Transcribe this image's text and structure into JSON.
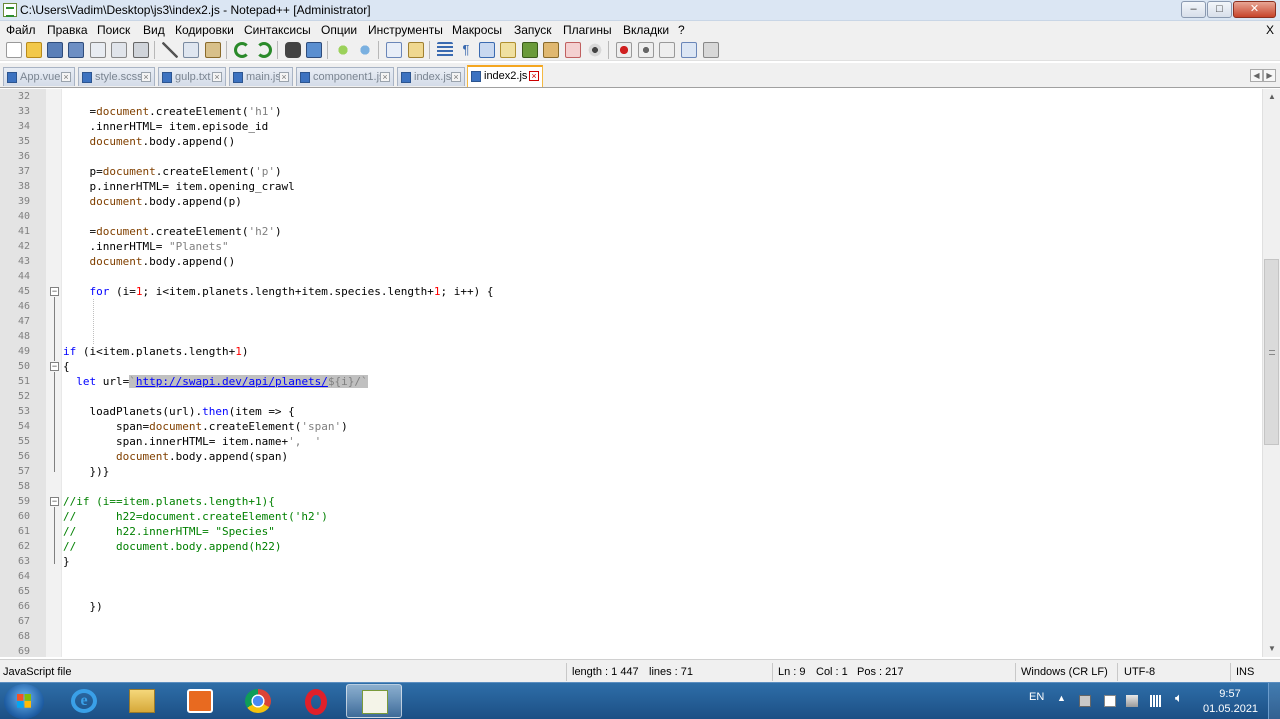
{
  "window": {
    "title": "C:\\Users\\Vadim\\Desktop\\js3\\index2.js - Notepad++ [Administrator]",
    "minimize": "–",
    "maximize": "□",
    "close": "✕"
  },
  "menu": {
    "items": [
      "Файл",
      "Правка",
      "Поиск",
      "Вид",
      "Кодировки",
      "Синтаксисы",
      "Опции",
      "Инструменты",
      "Макросы",
      "Запуск",
      "Плагины",
      "Вкладки",
      "?"
    ],
    "close_label": "X"
  },
  "tabs": [
    {
      "label": "App.vue"
    },
    {
      "label": "style.scss"
    },
    {
      "label": "gulp.txt"
    },
    {
      "label": "main.js"
    },
    {
      "label": "component1.js"
    },
    {
      "label": "index.js"
    },
    {
      "label": "index2.js",
      "active": true
    }
  ],
  "editor": {
    "lines": [
      {
        "n": "32",
        "t": ""
      },
      {
        "n": "33",
        "t": "    h1=document.createElement('h1')"
      },
      {
        "n": "34",
        "t": "    h1.innerHTML= item.episode_id"
      },
      {
        "n": "35",
        "t": "    document.body.append(h1)"
      },
      {
        "n": "36",
        "t": ""
      },
      {
        "n": "37",
        "t": "    p=document.createElement('p')"
      },
      {
        "n": "38",
        "t": "    p.innerHTML= item.opening_crawl"
      },
      {
        "n": "39",
        "t": "    document.body.append(p)"
      },
      {
        "n": "40",
        "t": ""
      },
      {
        "n": "41",
        "t": "    h2=document.createElement('h2')"
      },
      {
        "n": "42",
        "t": "    h2.innerHTML= \"Planets\""
      },
      {
        "n": "43",
        "t": "    document.body.append(h2)"
      },
      {
        "n": "44",
        "t": ""
      },
      {
        "n": "45",
        "t": "    for (i=1; i<item.planets.length+item.species.length+1; i++) {"
      },
      {
        "n": "46",
        "t": ""
      },
      {
        "n": "47",
        "t": ""
      },
      {
        "n": "48",
        "t": ""
      },
      {
        "n": "49",
        "t": "if (i<item.planets.length+1)"
      },
      {
        "n": "50",
        "t": "{"
      },
      {
        "n": "51",
        "t": "  let url=`http://swapi.dev/api/planets/${i}/`"
      },
      {
        "n": "52",
        "t": ""
      },
      {
        "n": "53",
        "t": "    loadPlanets(url).then(item => {"
      },
      {
        "n": "54",
        "t": "        span=document.createElement('span')"
      },
      {
        "n": "55",
        "t": "        span.innerHTML= item.name+',  '"
      },
      {
        "n": "56",
        "t": "        document.body.append(span)"
      },
      {
        "n": "57",
        "t": "    })}"
      },
      {
        "n": "58",
        "t": ""
      },
      {
        "n": "59",
        "t": "//if (i==item.planets.length+1){"
      },
      {
        "n": "60",
        "t": "//      h22=document.createElement('h2')"
      },
      {
        "n": "61",
        "t": "//      h22.innerHTML= \"Species\""
      },
      {
        "n": "62",
        "t": "//      document.body.append(h22)"
      },
      {
        "n": "63",
        "t": "}"
      },
      {
        "n": "64",
        "t": ""
      },
      {
        "n": "65",
        "t": ""
      },
      {
        "n": "66",
        "t": "    })"
      },
      {
        "n": "67",
        "t": ""
      },
      {
        "n": "68",
        "t": ""
      },
      {
        "n": "69",
        "t": ""
      }
    ]
  },
  "statusbar": {
    "file_type": "JavaScript file",
    "length": "length : 1 447",
    "lines": "lines : 71",
    "ln": "Ln : 9",
    "col": "Col : 1",
    "pos": "Pos : 217",
    "eol": "Windows (CR LF)",
    "encoding": "UTF-8",
    "mode": "INS"
  },
  "taskbar": {
    "language": "EN",
    "time": "9:57",
    "date": "01.05.2021",
    "apps": [
      {
        "icon": "internet-explorer-icon"
      },
      {
        "icon": "file-explorer-icon"
      },
      {
        "icon": "media-player-icon"
      },
      {
        "icon": "chrome-icon"
      },
      {
        "icon": "opera-icon"
      },
      {
        "icon": "notepad-plus-plus-icon",
        "active": true
      }
    ]
  }
}
